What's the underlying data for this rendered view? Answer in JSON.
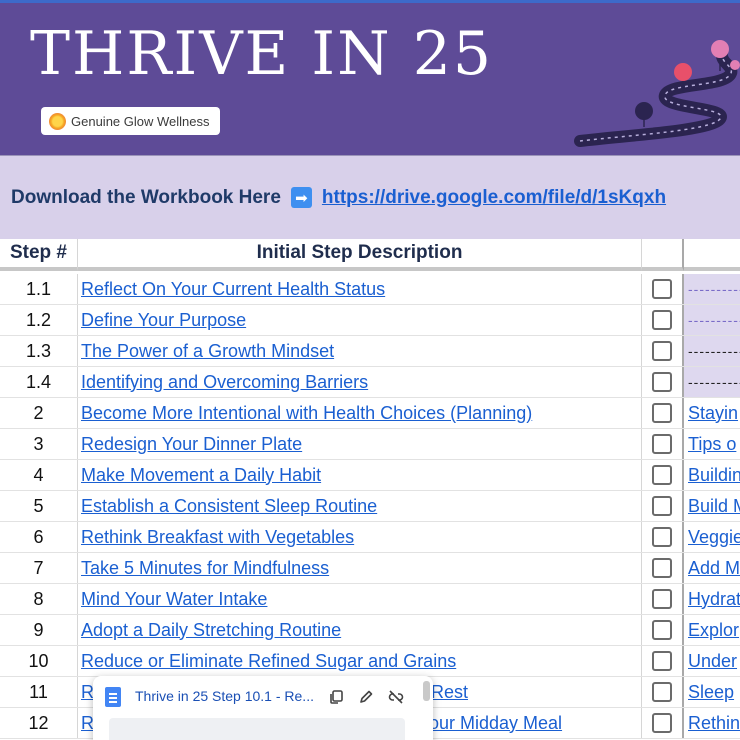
{
  "banner": {
    "title": "THRIVE IN 25",
    "logo_text": "Genuine Glow Wellness"
  },
  "download": {
    "label": "Download the Workbook Here",
    "arrow": "➡",
    "link": "https://drive.google.com/file/d/1sKqxh"
  },
  "table": {
    "headers": {
      "step": "Step #",
      "description": "Initial Step Description"
    },
    "rows": [
      {
        "step": "1.1",
        "desc": "Reflect On Your Current Health Status",
        "next": "----------",
        "next_style": "dash"
      },
      {
        "step": "1.2",
        "desc": "Define Your Purpose",
        "next": "----------",
        "next_style": "dash"
      },
      {
        "step": "1.3",
        "desc": "The Power of a Growth Mindset",
        "next": "----------",
        "next_style": "dark"
      },
      {
        "step": "1.4",
        "desc": "Identifying and Overcoming Barriers",
        "next": "----------",
        "next_style": "dark"
      },
      {
        "step": "2",
        "desc": "Become More Intentional with Health Choices (Planning)",
        "next": "Stayin",
        "next_style": "link"
      },
      {
        "step": "3",
        "desc": "Redesign Your Dinner Plate",
        "next": "Tips o",
        "next_style": "link"
      },
      {
        "step": "4",
        "desc": "Make Movement a Daily Habit",
        "next": "Buildin",
        "next_style": "link"
      },
      {
        "step": "5",
        "desc": "Establish a Consistent Sleep Routine",
        "next": "Build M",
        "next_style": "link"
      },
      {
        "step": "6",
        "desc": "Rethink Breakfast with Vegetables",
        "next": "Veggie",
        "next_style": "link"
      },
      {
        "step": "7",
        "desc": "Take 5 Minutes for Mindfulness",
        "next": "Add M",
        "next_style": "link"
      },
      {
        "step": "8",
        "desc": "Mind Your Water Intake",
        "next": "Hydrat",
        "next_style": "link"
      },
      {
        "step": "9",
        "desc": "Adopt a Daily Stretching Routine",
        "next": "Explor",
        "next_style": "link"
      },
      {
        "step": "10",
        "desc": "Reduce or Eliminate Refined Sugar and Grains",
        "next": "Under",
        "next_style": "link"
      },
      {
        "step": "11",
        "desc": "R",
        "desc_tail": "Rest",
        "next": "Sleep",
        "next_style": "link"
      },
      {
        "step": "12",
        "desc": "R",
        "desc_tail": "our Midday Meal",
        "next": "Rethin",
        "next_style": "link"
      }
    ]
  },
  "popup": {
    "title": "Thrive in 25 Step 10.1 - Re...",
    "icons": [
      "doc-icon",
      "copy-icon",
      "edit-icon",
      "unlink-icon"
    ]
  },
  "colors": {
    "banner": "#5e4b97",
    "download_bar": "#d8d0ea",
    "link": "#1a5fd1"
  }
}
